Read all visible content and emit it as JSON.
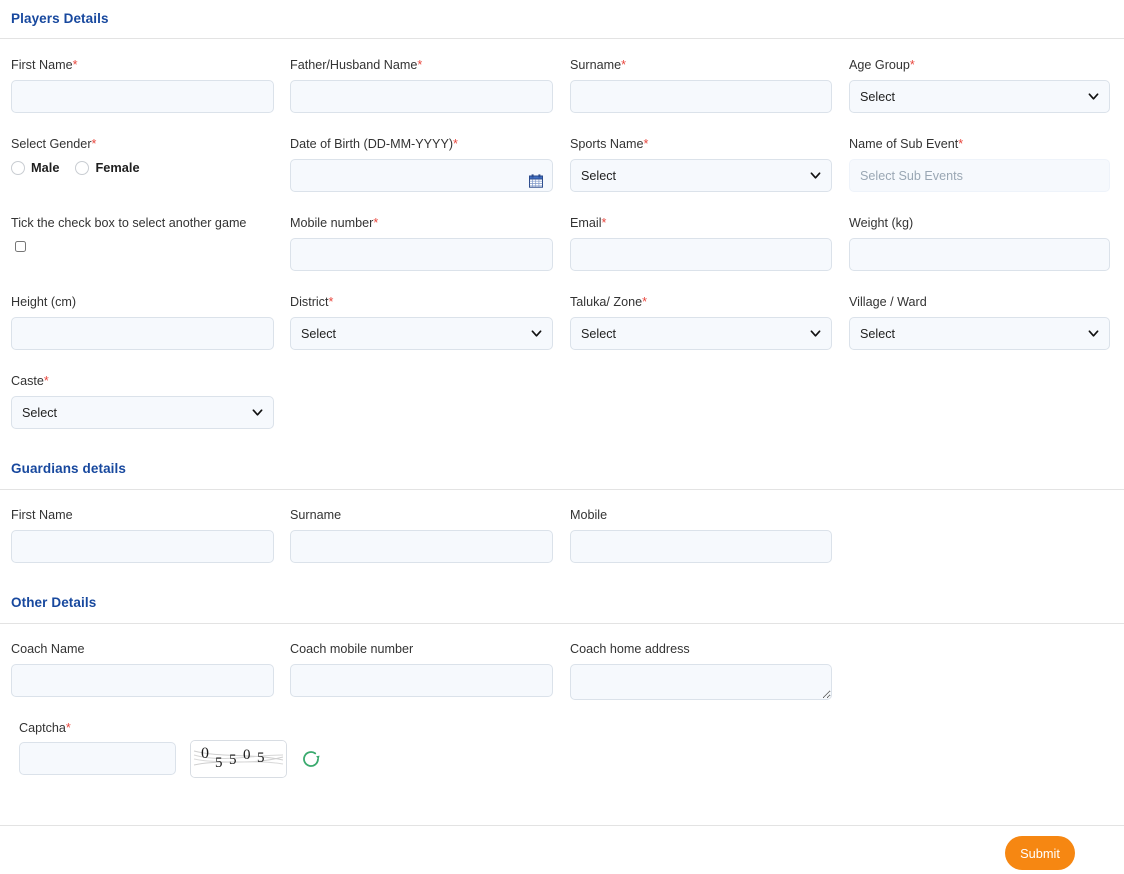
{
  "colors": {
    "heading": "#17489e",
    "required_asterisk": "#e8453c",
    "input_bg": "#f6f9fd",
    "input_border": "#dbe2ea",
    "submit_bg": "#f68712",
    "captcha_refresh": "#3aaa6e"
  },
  "sections": {
    "players": {
      "title": "Players Details"
    },
    "guardians": {
      "title": "Guardians details"
    },
    "other": {
      "title": "Other Details"
    }
  },
  "players": {
    "first_name": {
      "label": "First Name",
      "required": "*",
      "value": "",
      "placeholder": ""
    },
    "father_name": {
      "label": "Father/Husband Name",
      "required": "*",
      "value": "",
      "placeholder": ""
    },
    "surname": {
      "label": "Surname",
      "required": "*",
      "value": "",
      "placeholder": ""
    },
    "age_group": {
      "label": "Age Group",
      "required": "*",
      "selected": "Select"
    },
    "gender": {
      "label": "Select Gender",
      "required": "*",
      "options": [
        "Male",
        "Female"
      ]
    },
    "dob": {
      "label": "Date of Birth (DD-MM-YYYY)",
      "required": "*",
      "value": "",
      "placeholder": ""
    },
    "sports_name": {
      "label": "Sports Name",
      "required": "*",
      "selected": "Select"
    },
    "sub_event": {
      "label": "Name of Sub Event",
      "required": "*",
      "value": "",
      "placeholder": "Select Sub Events"
    },
    "another_game": {
      "label": "Tick the check box to select another game",
      "checked": false
    },
    "mobile_number": {
      "label": "Mobile number",
      "required": "*",
      "value": "",
      "placeholder": ""
    },
    "email": {
      "label": "Email",
      "required": "*",
      "value": "",
      "placeholder": ""
    },
    "weight": {
      "label": "Weight (kg)",
      "required": "",
      "value": "",
      "placeholder": ""
    },
    "height": {
      "label": "Height (cm)",
      "required": "",
      "value": "",
      "placeholder": ""
    },
    "district": {
      "label": "District",
      "required": "*",
      "selected": "Select"
    },
    "taluka_zone": {
      "label": "Taluka/ Zone",
      "required": "*",
      "selected": "Select"
    },
    "village_ward": {
      "label": "Village / Ward",
      "required": "",
      "selected": "Select"
    },
    "caste": {
      "label": "Caste",
      "required": "*",
      "selected": "Select"
    }
  },
  "guardians": {
    "first_name": {
      "label": "First Name",
      "value": "",
      "placeholder": ""
    },
    "surname": {
      "label": "Surname",
      "value": "",
      "placeholder": ""
    },
    "mobile": {
      "label": "Mobile",
      "value": "",
      "placeholder": ""
    }
  },
  "other": {
    "coach_name": {
      "label": "Coach Name",
      "value": "",
      "placeholder": ""
    },
    "coach_mobile_number": {
      "label": "Coach mobile number",
      "value": "",
      "placeholder": ""
    },
    "coach_home_address": {
      "label": "Coach home address",
      "value": "",
      "placeholder": ""
    }
  },
  "captcha": {
    "label": "Captcha",
    "required": "*",
    "value": "",
    "placeholder": "",
    "code": "05505",
    "digits": [
      "0",
      "5",
      "5",
      "0",
      "5"
    ],
    "refresh_icon": "refresh-icon"
  },
  "footer": {
    "submit_label": "Submit"
  },
  "icons": {
    "calendar": "calendar-icon",
    "chevron_down": "chevron-down-icon"
  }
}
